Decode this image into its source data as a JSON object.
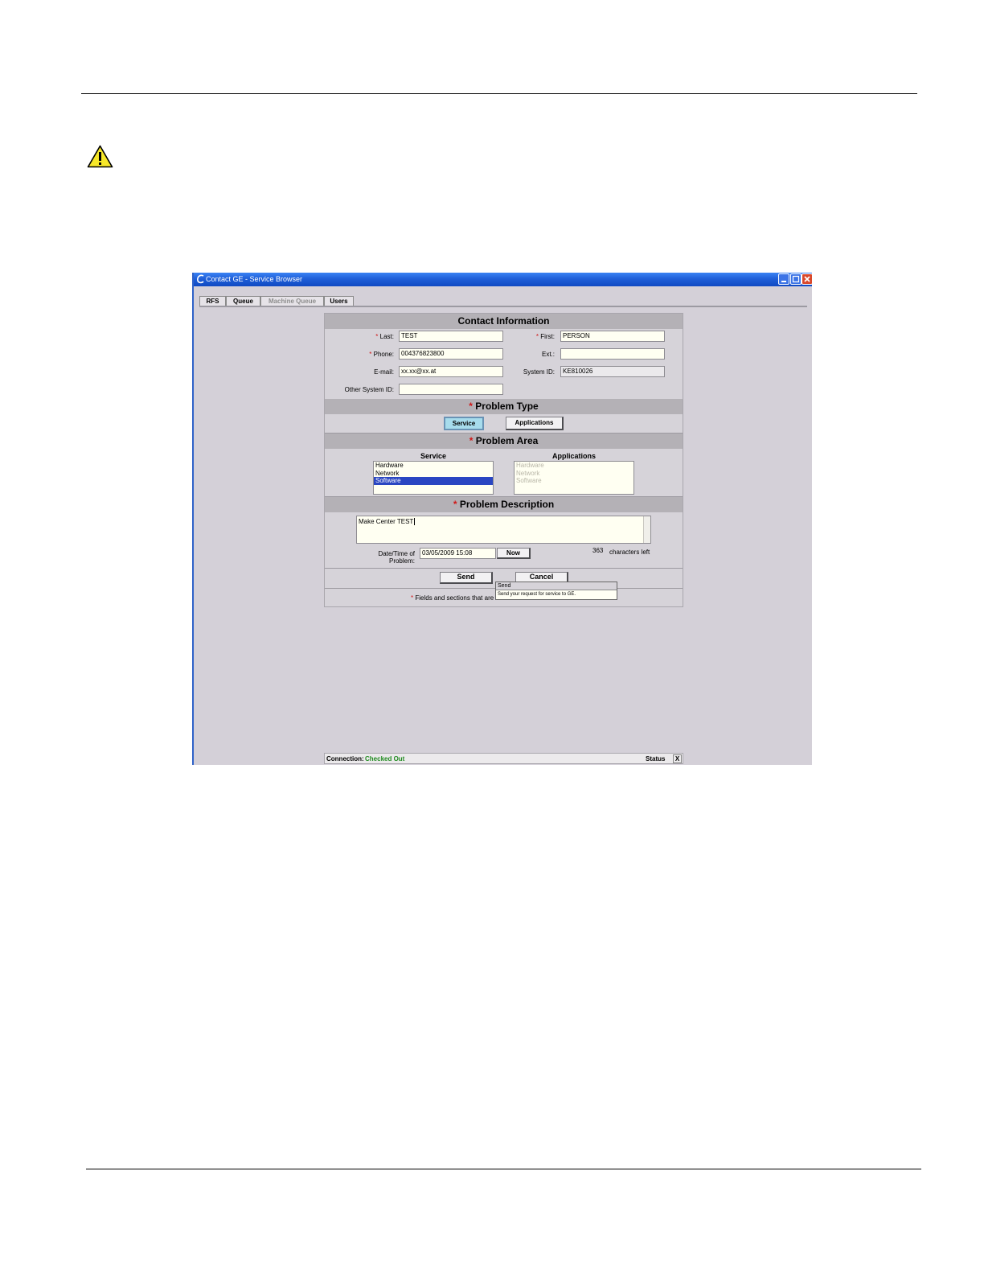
{
  "window": {
    "title": "Contact GE - Service Browser"
  },
  "tabs": [
    {
      "label": "RFS",
      "enabled": true
    },
    {
      "label": "Queue",
      "enabled": true
    },
    {
      "label": "Machine Queue",
      "enabled": false
    },
    {
      "label": "Users",
      "enabled": true
    }
  ],
  "contact": {
    "header": "Contact Information",
    "required_mark": "*",
    "last_label": "Last:",
    "last_value": "TEST",
    "first_label": "First:",
    "first_value": "PERSON",
    "phone_label": "Phone:",
    "phone_value": "004376823800",
    "ext_label": "Ext.:",
    "ext_value": "",
    "email_label": "E-mail:",
    "email_value": "xx.xx@xx.at",
    "system_id_label": "System ID:",
    "system_id_value": "KE810026",
    "other_system_id_label": "Other System ID:",
    "other_system_id_value": ""
  },
  "problem_type": {
    "header": "Problem Type",
    "service_button": "Service",
    "applications_button": "Applications",
    "selected": "Service"
  },
  "problem_area": {
    "header": "Problem Area",
    "service_heading": "Service",
    "applications_heading": "Applications",
    "service_items": [
      "Hardware",
      "Network",
      "Software"
    ],
    "service_selected": "Software",
    "applications_items": [
      "Hardware",
      "Network",
      "Software"
    ]
  },
  "problem_description": {
    "header": "Problem Description",
    "text": "Make Center TEST",
    "datetime_label_line1": "Date/Time of",
    "datetime_label_line2": "Problem:",
    "datetime_value": "03/05/2009 15:08",
    "now_button": "Now",
    "chars_count": "363",
    "chars_label": "characters left"
  },
  "actions": {
    "send_button": "Send",
    "cancel_button": "Cancel"
  },
  "footnote": {
    "mark": "*",
    "text": "Fields and sections that are"
  },
  "tooltip": {
    "title": "Send",
    "text": "Send your request for service to GE."
  },
  "status_bar": {
    "connection_label": "Connection:",
    "connection_value": "Checked Out",
    "status_label": "Status",
    "close_label": "X"
  },
  "colors": {
    "title_bar": "#1f5fd8",
    "required": "#d01818",
    "connection_ok": "#1f8a1f",
    "selected_item": "#2a46c2",
    "active_button": "#a7dcec"
  },
  "icons": {
    "warning": "warning-icon",
    "title": "ge-browser-icon"
  }
}
